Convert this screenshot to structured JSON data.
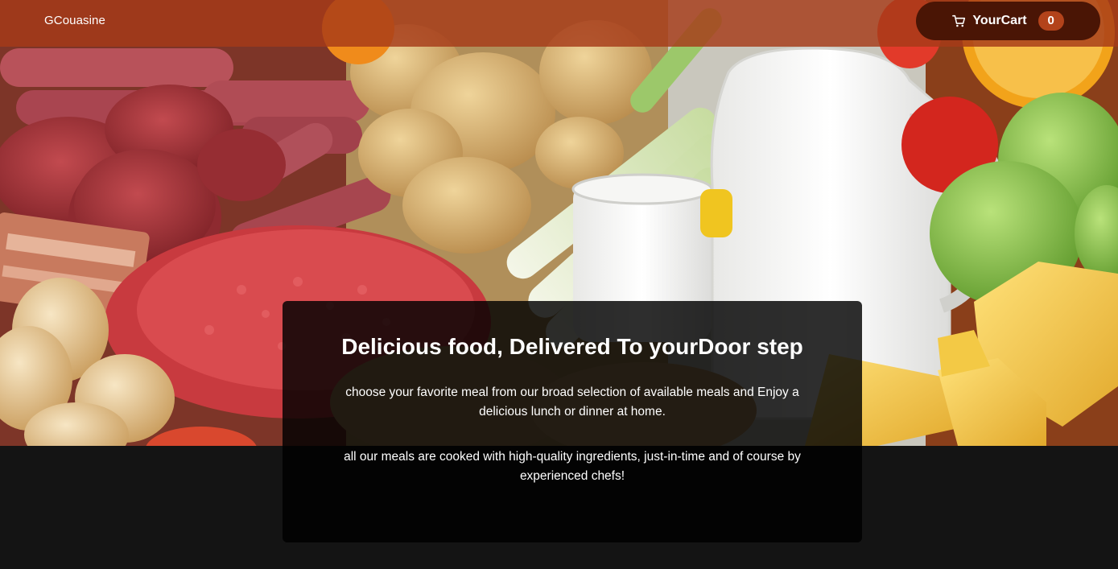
{
  "header": {
    "logo": "GCouasine",
    "cart": {
      "label": "YourCart",
      "count": "0",
      "icon": "cart-icon"
    }
  },
  "hero": {
    "image_subject": "meat, potatoes, leeks, milk, cheese, onions, apples and orange"
  },
  "summary": {
    "title": "Delicious food, Delivered To yourDoor step",
    "paragraph_1": "choose your favorite meal from our broad selection of available meals and Enjoy a delicious lunch or dinner at home.",
    "paragraph_2": "all our meals are cooked with high-quality ingredients, just-in-time and of course by experienced chefs!"
  },
  "colors": {
    "header_overlay": "#a63a18",
    "cart_button": "#4a1505",
    "cart_badge": "#b3431b",
    "page_background": "#141414"
  }
}
